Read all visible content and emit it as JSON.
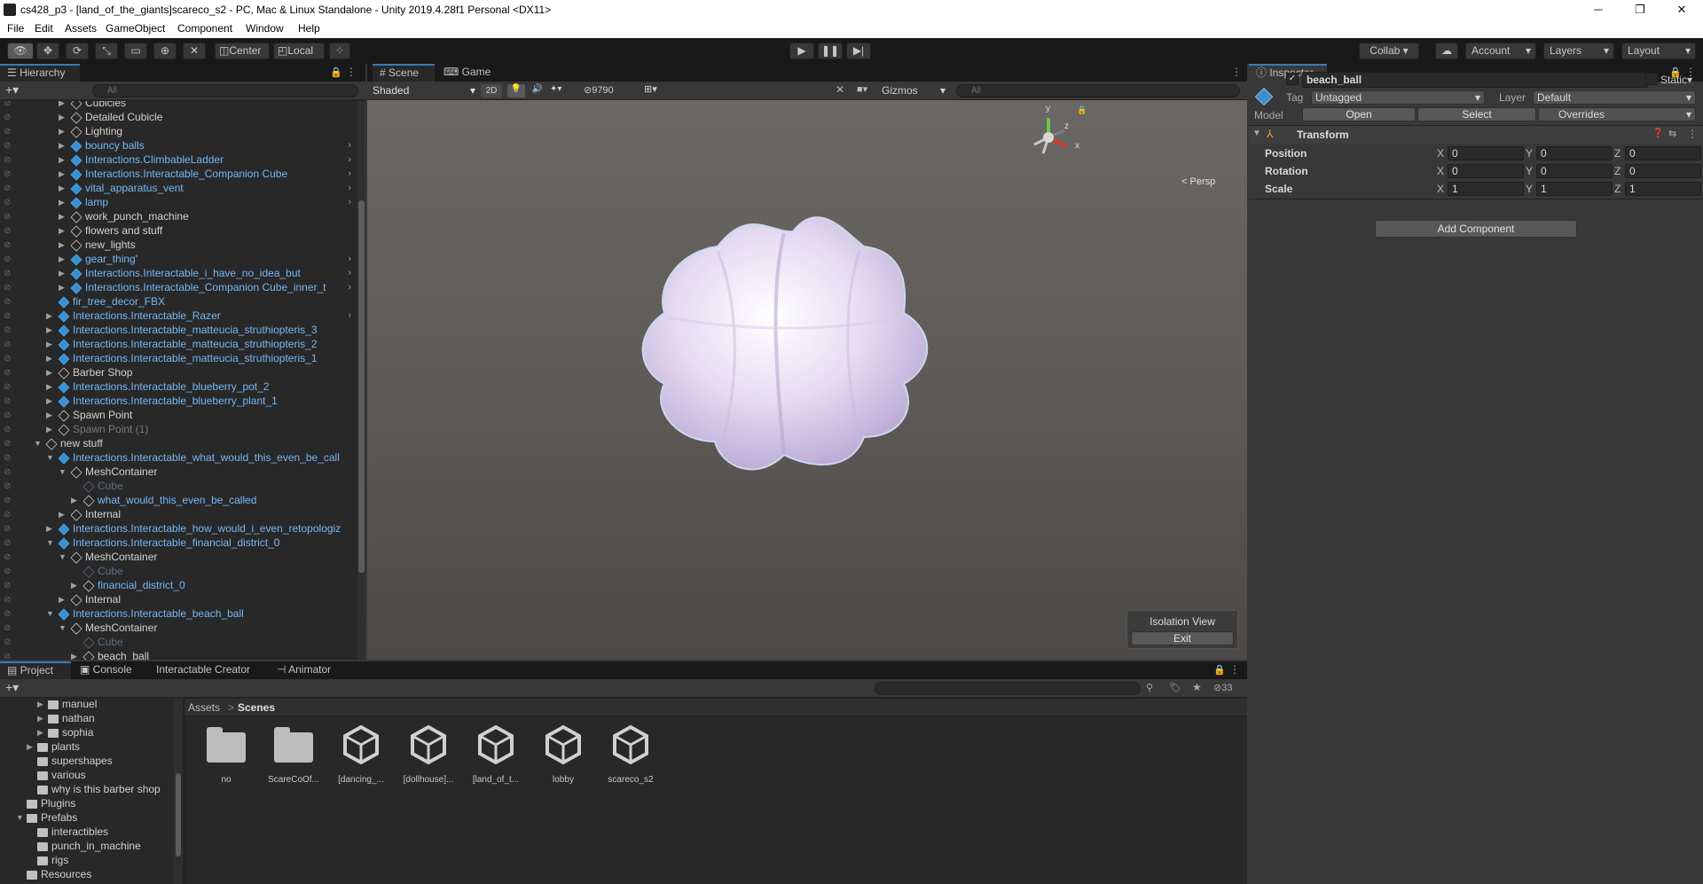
{
  "window": {
    "title": "cs428_p3 - [land_of_the_giants]scareco_s2 - PC, Mac & Linux Standalone - Unity 2019.4.28f1 Personal <DX11>",
    "minimize": "─",
    "maximize": "❐",
    "close": "✕"
  },
  "menu": [
    "File",
    "Edit",
    "Assets",
    "GameObject",
    "Component",
    "Window",
    "Help"
  ],
  "toolbar": {
    "pivot": "Center",
    "space": "Local",
    "collab": "Collab ▾",
    "account": "Account",
    "layers": "Layers",
    "layout": "Layout"
  },
  "hierarchy": {
    "tab": "Hierarchy",
    "search_placeholder": "All",
    "items": [
      {
        "label": "Cubicles",
        "indent": 3,
        "icon": "cube",
        "style": "normal",
        "arrow": "right",
        "chevron": false
      },
      {
        "label": "Detailed Cubicle",
        "indent": 3,
        "icon": "cube",
        "style": "normal",
        "arrow": "right",
        "chevron": false
      },
      {
        "label": "Lighting",
        "indent": 3,
        "icon": "cube",
        "style": "normal",
        "arrow": "right",
        "chevron": false
      },
      {
        "label": "bouncy balls",
        "indent": 3,
        "icon": "prefab",
        "style": "blue",
        "arrow": "right",
        "chevron": true
      },
      {
        "label": "Interactions.ClimbableLadder",
        "indent": 3,
        "icon": "prefab",
        "style": "blue",
        "arrow": "right",
        "chevron": true
      },
      {
        "label": "Interactions.Interactable_Companion Cube",
        "indent": 3,
        "icon": "prefab",
        "style": "blue",
        "arrow": "right",
        "chevron": true
      },
      {
        "label": "vital_apparatus_vent",
        "indent": 3,
        "icon": "prefab",
        "style": "blue",
        "arrow": "right",
        "chevron": true
      },
      {
        "label": "lamp",
        "indent": 3,
        "icon": "prefab",
        "style": "blue",
        "arrow": "right",
        "chevron": true
      },
      {
        "label": "work_punch_machine",
        "indent": 3,
        "icon": "cube",
        "style": "normal",
        "arrow": "right",
        "chevron": false
      },
      {
        "label": "flowers and stuff",
        "indent": 3,
        "icon": "cube",
        "style": "normal",
        "arrow": "right",
        "chevron": false
      },
      {
        "label": "new_lights",
        "indent": 3,
        "icon": "cube",
        "style": "normal",
        "arrow": "right",
        "chevron": false
      },
      {
        "label": "gear_thing'",
        "indent": 3,
        "icon": "prefab",
        "style": "blue",
        "arrow": "right",
        "chevron": true
      },
      {
        "label": "Interactions.Interactable_i_have_no_idea_but",
        "indent": 3,
        "icon": "prefab",
        "style": "blue",
        "arrow": "right",
        "chevron": true
      },
      {
        "label": "Interactions.Interactable_Companion Cube_inner_t",
        "indent": 3,
        "icon": "prefab",
        "style": "blue",
        "arrow": "right",
        "chevron": true
      },
      {
        "label": "fir_tree_decor_FBX",
        "indent": 2,
        "icon": "prefab",
        "style": "blue",
        "arrow": "none",
        "chevron": false
      },
      {
        "label": "Interactions.Interactable_Razer",
        "indent": 2,
        "icon": "prefab",
        "style": "blue",
        "arrow": "right",
        "chevron": true
      },
      {
        "label": "Interactions.Interactable_matteucia_struthiopteris_3",
        "indent": 2,
        "icon": "prefab",
        "style": "blue",
        "arrow": "right",
        "chevron": false
      },
      {
        "label": "Interactions.Interactable_matteucia_struthiopteris_2",
        "indent": 2,
        "icon": "prefab",
        "style": "blue",
        "arrow": "right",
        "chevron": false
      },
      {
        "label": "Interactions.Interactable_matteucia_struthiopteris_1",
        "indent": 2,
        "icon": "prefab",
        "style": "blue",
        "arrow": "right",
        "chevron": false
      },
      {
        "label": "Barber Shop",
        "indent": 2,
        "icon": "cube",
        "style": "normal",
        "arrow": "right",
        "chevron": false
      },
      {
        "label": "Interactions.Interactable_blueberry_pot_2",
        "indent": 2,
        "icon": "prefab",
        "style": "blue",
        "arrow": "right",
        "chevron": false
      },
      {
        "label": "Interactions.Interactable_blueberry_plant_1",
        "indent": 2,
        "icon": "prefab",
        "style": "blue",
        "arrow": "right",
        "chevron": false
      },
      {
        "label": "Spawn Point",
        "indent": 2,
        "icon": "cube",
        "style": "normal",
        "arrow": "right",
        "chevron": false
      },
      {
        "label": "Spawn Point (1)",
        "indent": 2,
        "icon": "cube",
        "style": "gray",
        "arrow": "right",
        "chevron": false
      },
      {
        "label": "new stuff",
        "indent": 1,
        "icon": "cube",
        "style": "normal",
        "arrow": "down",
        "chevron": false
      },
      {
        "label": "Interactions.Interactable_what_would_this_even_be_call",
        "indent": 2,
        "icon": "prefab",
        "style": "blue",
        "arrow": "down",
        "chevron": false
      },
      {
        "label": "MeshContainer",
        "indent": 3,
        "icon": "cube",
        "style": "normal",
        "arrow": "down",
        "chevron": false
      },
      {
        "label": "Cube",
        "indent": 4,
        "icon": "dim",
        "style": "dim",
        "arrow": "none",
        "chevron": false
      },
      {
        "label": "what_would_this_even_be_called",
        "indent": 4,
        "icon": "cube",
        "style": "blue",
        "arrow": "right",
        "chevron": false
      },
      {
        "label": "Internal",
        "indent": 3,
        "icon": "cube",
        "style": "normal",
        "arrow": "right",
        "chevron": false
      },
      {
        "label": "Interactions.Interactable_how_would_i_even_retopologiz",
        "indent": 2,
        "icon": "prefab",
        "style": "blue",
        "arrow": "right",
        "chevron": false
      },
      {
        "label": "Interactions.Interactable_financial_district_0",
        "indent": 2,
        "icon": "prefab",
        "style": "blue",
        "arrow": "down",
        "chevron": false
      },
      {
        "label": "MeshContainer",
        "indent": 3,
        "icon": "cube",
        "style": "normal",
        "arrow": "down",
        "chevron": false
      },
      {
        "label": "Cube",
        "indent": 4,
        "icon": "dim",
        "style": "dim",
        "arrow": "none",
        "chevron": false
      },
      {
        "label": "financial_district_0",
        "indent": 4,
        "icon": "cube",
        "style": "blue",
        "arrow": "right",
        "chevron": false
      },
      {
        "label": "Internal",
        "indent": 3,
        "icon": "cube",
        "style": "normal",
        "arrow": "right",
        "chevron": false
      },
      {
        "label": "Interactions.Interactable_beach_ball",
        "indent": 2,
        "icon": "prefab",
        "style": "blue",
        "arrow": "down",
        "chevron": false
      },
      {
        "label": "MeshContainer",
        "indent": 3,
        "icon": "cube",
        "style": "normal",
        "arrow": "down",
        "chevron": false
      },
      {
        "label": "Cube",
        "indent": 4,
        "icon": "dim",
        "style": "dim",
        "arrow": "none",
        "chevron": false
      },
      {
        "label": "beach_ball",
        "indent": 4,
        "icon": "cube",
        "style": "normal",
        "arrow": "right",
        "chevron": false
      }
    ]
  },
  "scene": {
    "tab_scene": "Scene",
    "tab_game": "Game",
    "shading": "Shaded",
    "mode_2d": "2D",
    "hidden_count": "9790",
    "gizmos": "Gizmos",
    "search_placeholder": "All",
    "persp": "Persp",
    "axis_y": "y",
    "axis_z": "z",
    "axis_x": "x",
    "isolation_title": "Isolation View",
    "isolation_exit": "Exit"
  },
  "inspector": {
    "tab": "Inspector",
    "object_name": "beach_ball",
    "static_label": "Static",
    "tag_label": "Tag",
    "tag_value": "Untagged",
    "layer_label": "Layer",
    "layer_value": "Default",
    "model_label": "Model",
    "open_btn": "Open",
    "select_btn": "Select",
    "overrides": "Overrides",
    "component": "Transform",
    "rows": [
      {
        "label": "Position",
        "x": "0",
        "y": "0",
        "z": "0"
      },
      {
        "label": "Rotation",
        "x": "0",
        "y": "0",
        "z": "0"
      },
      {
        "label": "Scale",
        "x": "1",
        "y": "1",
        "z": "1"
      }
    ],
    "axis_labels": {
      "x": "X",
      "y": "Y",
      "z": "Z"
    },
    "add_component": "Add Component"
  },
  "bottom": {
    "tabs": [
      "Project",
      "Console",
      "Interactable Creator",
      "Animator"
    ],
    "hidden_count": "33",
    "breadcrumb_root": "Assets",
    "breadcrumb_sep": ">",
    "breadcrumb_current": "Scenes",
    "tree": [
      {
        "label": "manuel",
        "indent": 3,
        "arrow": "right"
      },
      {
        "label": "nathan",
        "indent": 3,
        "arrow": "right"
      },
      {
        "label": "sophia",
        "indent": 3,
        "arrow": "right"
      },
      {
        "label": "plants",
        "indent": 2,
        "arrow": "right"
      },
      {
        "label": "supershapes",
        "indent": 2,
        "arrow": "none"
      },
      {
        "label": "various",
        "indent": 2,
        "arrow": "none"
      },
      {
        "label": "why is this barber shop",
        "indent": 2,
        "arrow": "none"
      },
      {
        "label": "Plugins",
        "indent": 1,
        "arrow": "none"
      },
      {
        "label": "Prefabs",
        "indent": 1,
        "arrow": "down"
      },
      {
        "label": "interactibles",
        "indent": 2,
        "arrow": "none"
      },
      {
        "label": "punch_in_machine",
        "indent": 2,
        "arrow": "none"
      },
      {
        "label": "rigs",
        "indent": 2,
        "arrow": "none"
      },
      {
        "label": "Resources",
        "indent": 1,
        "arrow": "none"
      }
    ],
    "assets": [
      {
        "label": "no",
        "type": "folder"
      },
      {
        "label": "ScareCoOf...",
        "type": "folder"
      },
      {
        "label": "[dancing_...",
        "type": "scene"
      },
      {
        "label": "[dollhouse]...",
        "type": "scene"
      },
      {
        "label": "[land_of_t...",
        "type": "scene"
      },
      {
        "label": "lobby",
        "type": "scene"
      },
      {
        "label": "scareco_s2",
        "type": "scene"
      }
    ]
  }
}
